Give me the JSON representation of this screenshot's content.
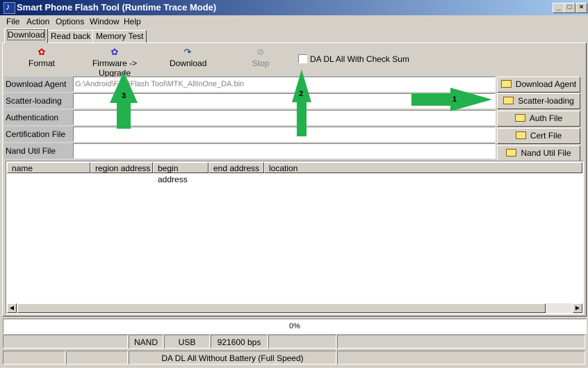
{
  "window": {
    "title": "Smart Phone Flash Tool (Runtime Trace Mode)"
  },
  "menu": [
    "File",
    "Action",
    "Options",
    "Window",
    "Help"
  ],
  "tabs": [
    "Download",
    "Read back",
    "Memory Test"
  ],
  "toolbar": {
    "format": "Format",
    "firmware_upgrade": "Firmware -> Upgrade",
    "download": "Download",
    "stop": "Stop",
    "checksum_label": "DA DL All With Check Sum"
  },
  "files": [
    {
      "label": "Download Agent",
      "value": "G:\\Android\\Folk\\Flash Tool\\MTK_AllInOne_DA.bin",
      "button": "Download Agent"
    },
    {
      "label": "Scatter-loading File",
      "value": "",
      "button": "Scatter-loading"
    },
    {
      "label": "Authentication File",
      "value": "",
      "button": "Auth File"
    },
    {
      "label": "Certification File",
      "value": "",
      "button": "Cert File"
    },
    {
      "label": "Nand Util File",
      "value": "",
      "button": "Nand Util File"
    }
  ],
  "columns": [
    "name",
    "region address",
    "begin address",
    "end address",
    "location"
  ],
  "progress": {
    "text": "0%",
    "value": 0
  },
  "status": {
    "row1": [
      "",
      "NAND",
      "USB",
      "921600 bps",
      "",
      ""
    ],
    "row2": [
      "",
      "",
      "DA DL All Without Battery (Full Speed)",
      ""
    ]
  },
  "annotations": [
    "1",
    "2",
    "3"
  ],
  "colors": {
    "arrow": "#22b14c",
    "titlebar": "#0a246a"
  }
}
